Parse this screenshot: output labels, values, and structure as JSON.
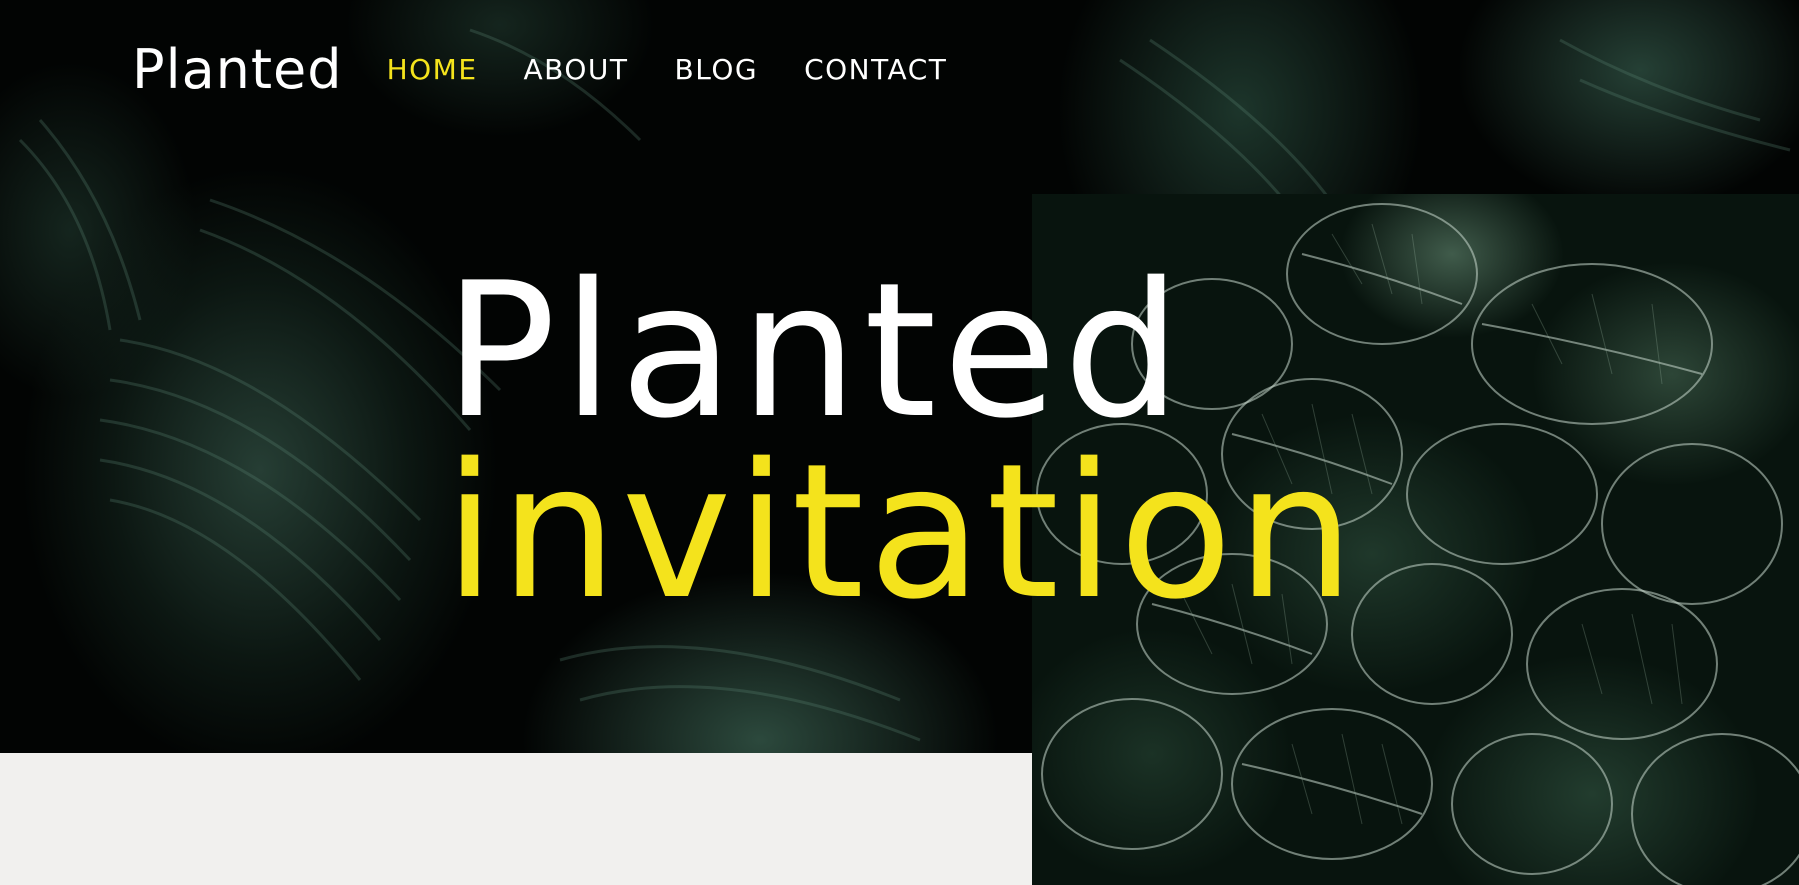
{
  "brand": {
    "logo_text": "Planted"
  },
  "nav": {
    "items": [
      {
        "label": "HOME",
        "active": true
      },
      {
        "label": "ABOUT",
        "active": false
      },
      {
        "label": "BLOG",
        "active": false
      },
      {
        "label": "CONTACT",
        "active": false
      }
    ]
  },
  "hero": {
    "title_line_1": "Planted",
    "title_line_2": "invitation"
  },
  "colors": {
    "accent": "#f4e31c",
    "text_light": "#ffffff",
    "hero_background": "#020403",
    "page_background": "#f1f0ee"
  }
}
